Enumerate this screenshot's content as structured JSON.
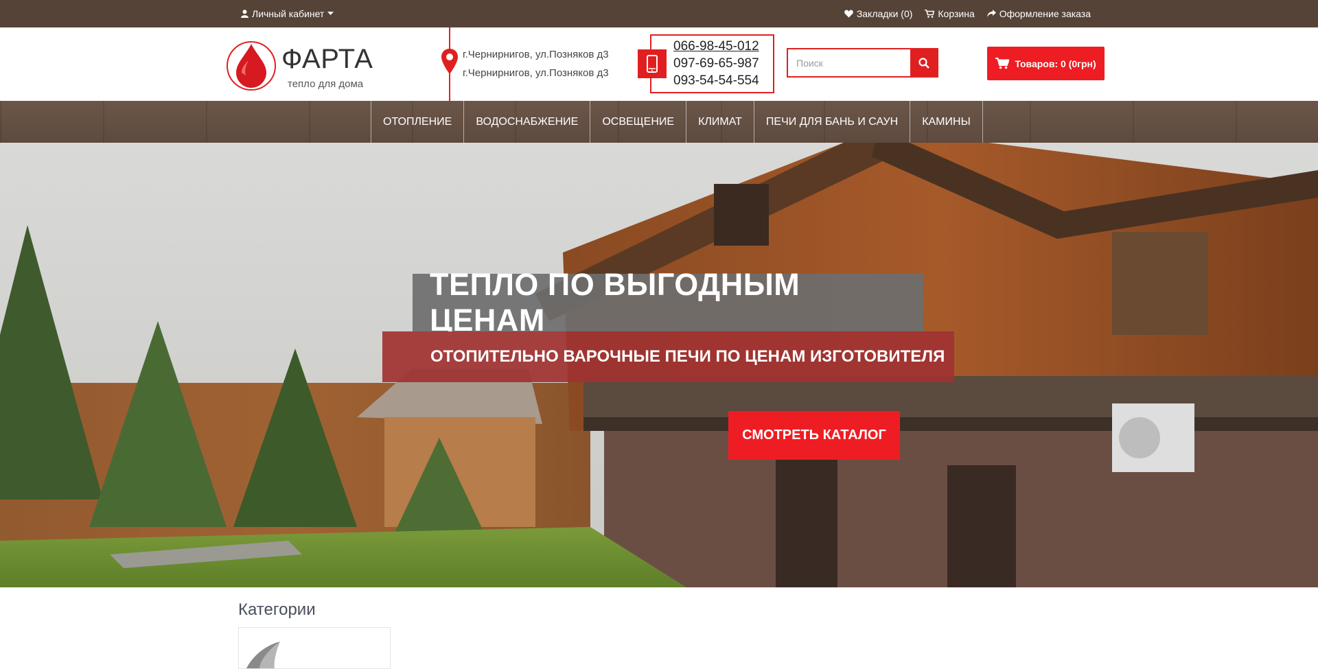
{
  "topbar": {
    "account_label": "Личный кабинет",
    "bookmarks_label": "Закладки (0)",
    "cart_label": "Корзина",
    "checkout_label": "Оформление заказа"
  },
  "header": {
    "logo_brand": "ФАРТА",
    "logo_tagline": "тепло для дома",
    "address_1": "г.Чернирнигов, ул.Позняков д3",
    "address_2": "г.Чернирнигов, ул.Позняков д3",
    "phones": [
      "066-98-45-012",
      "097-69-65-987",
      "093-54-54-554"
    ],
    "search_placeholder": "Поиск",
    "cart_button_label": "Товаров: 0 (0грн)"
  },
  "nav": {
    "items": [
      "ОТОПЛЕНИЕ",
      "ВОДОСНАБЖЕНИЕ",
      "ОСВЕЩЕНИЕ",
      "КЛИМАТ",
      "ПЕЧИ ДЛЯ БАНЬ И САУН",
      "КАМИНЫ"
    ]
  },
  "hero": {
    "headline": "ТЕПЛО ПО ВЫГОДНЫМ ЦЕНАМ",
    "subheadline": "ОТОПИТЕЛЬНО ВАРОЧНЫЕ ПЕЧИ ПО ЦЕНАМ ИЗГОТОВИТЕЛЯ",
    "cta_label": "СМОТРЕТЬ КАТАЛОГ"
  },
  "categories": {
    "title": "Категории"
  },
  "colors": {
    "topbar": "#554337",
    "accent": "#ee1d23",
    "nav": "#5e4a3e"
  }
}
